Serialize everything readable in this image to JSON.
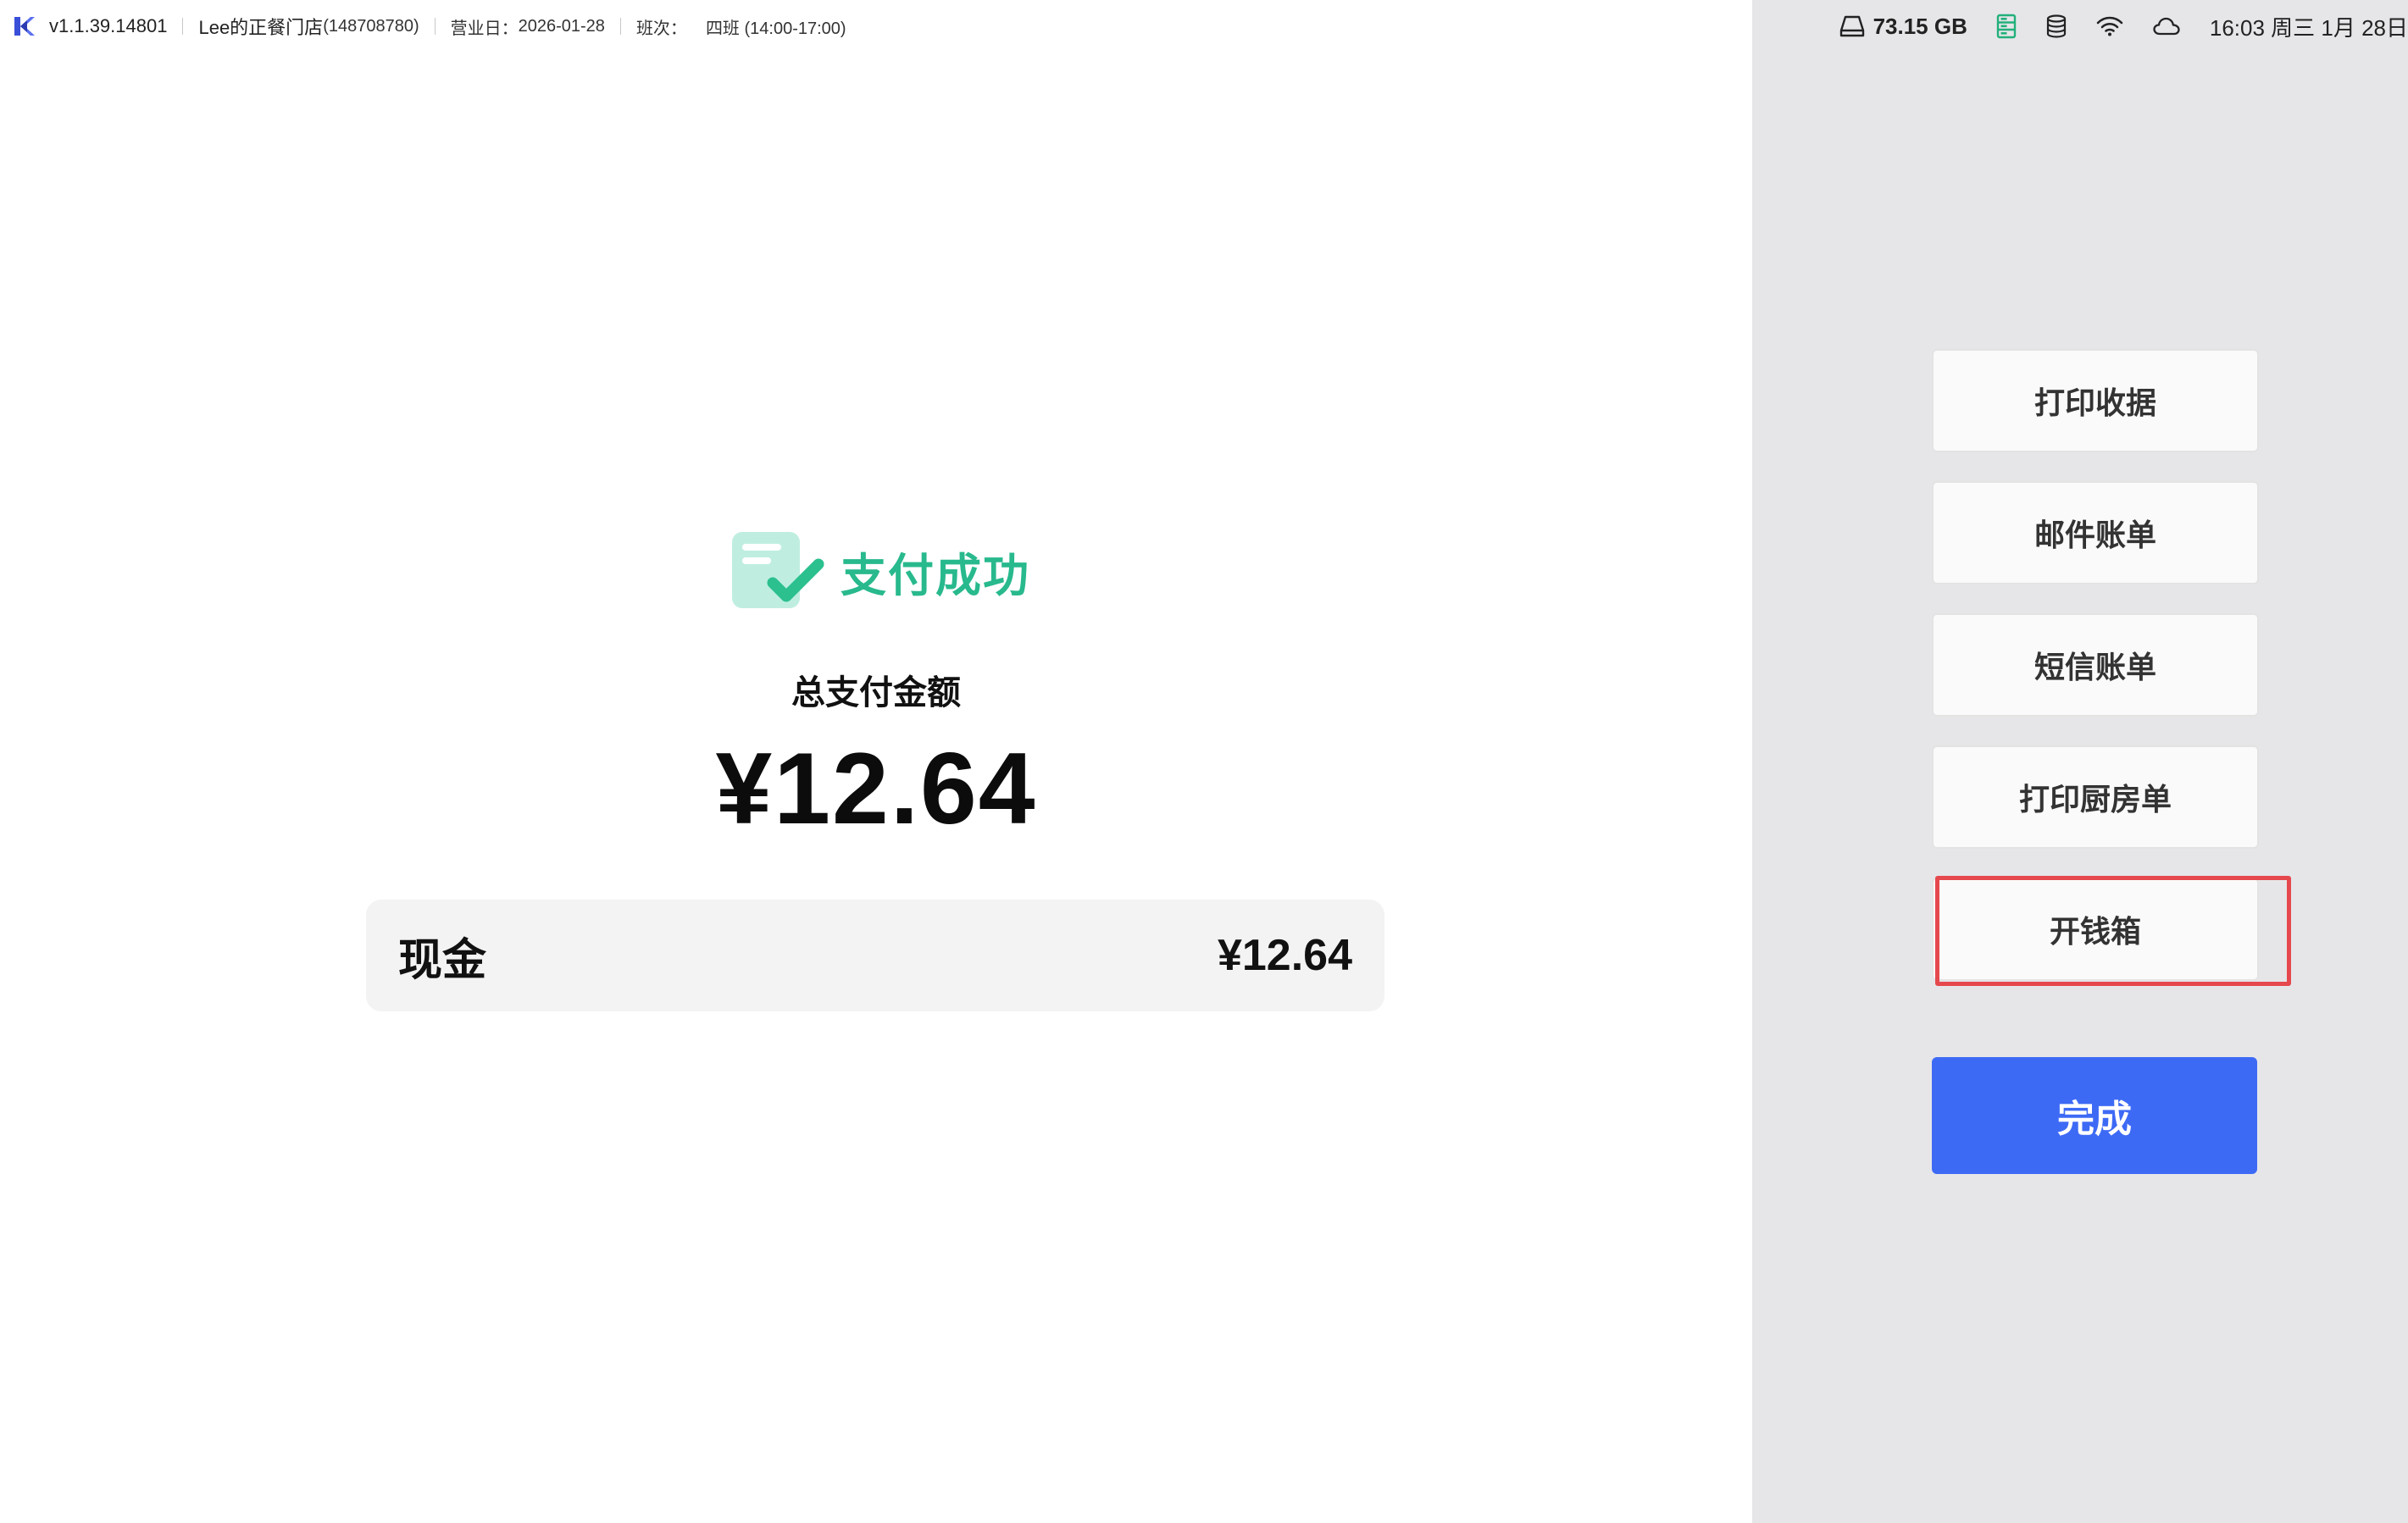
{
  "topbar": {
    "version": "v1.1.39.14801",
    "store_name": "Lee的正餐门店",
    "store_id": "(148708780)",
    "business_day_label": "营业日：",
    "business_day": "2026-01-28",
    "shift_label": "班次：",
    "shift_value": "四班 (14:00-17:00)",
    "disk": "73.15 GB",
    "clock": "16:03 周三 1月 28日"
  },
  "success": {
    "text": "支付成功",
    "accent": "#28b98d"
  },
  "total": {
    "label": "总支付金额",
    "amount": "¥12.64"
  },
  "payment": {
    "method": "现金",
    "amount": "¥12.64"
  },
  "actions": {
    "print_receipt": "打印收据",
    "email_bill": "邮件账单",
    "sms_bill": "短信账单",
    "print_kitchen": "打印厨房单",
    "open_drawer": "开钱箱",
    "done": "完成"
  },
  "colors": {
    "primary": "#3d6af5",
    "highlight": "#e5484d",
    "side_bg": "#e6e6e9"
  },
  "icons": {
    "app": "app-logo-icon",
    "disk": "hard-drive-icon",
    "server": "server-icon",
    "database": "database-icon",
    "wifi": "wifi-icon",
    "cloud": "cloud-icon",
    "success": "receipt-check-icon"
  }
}
